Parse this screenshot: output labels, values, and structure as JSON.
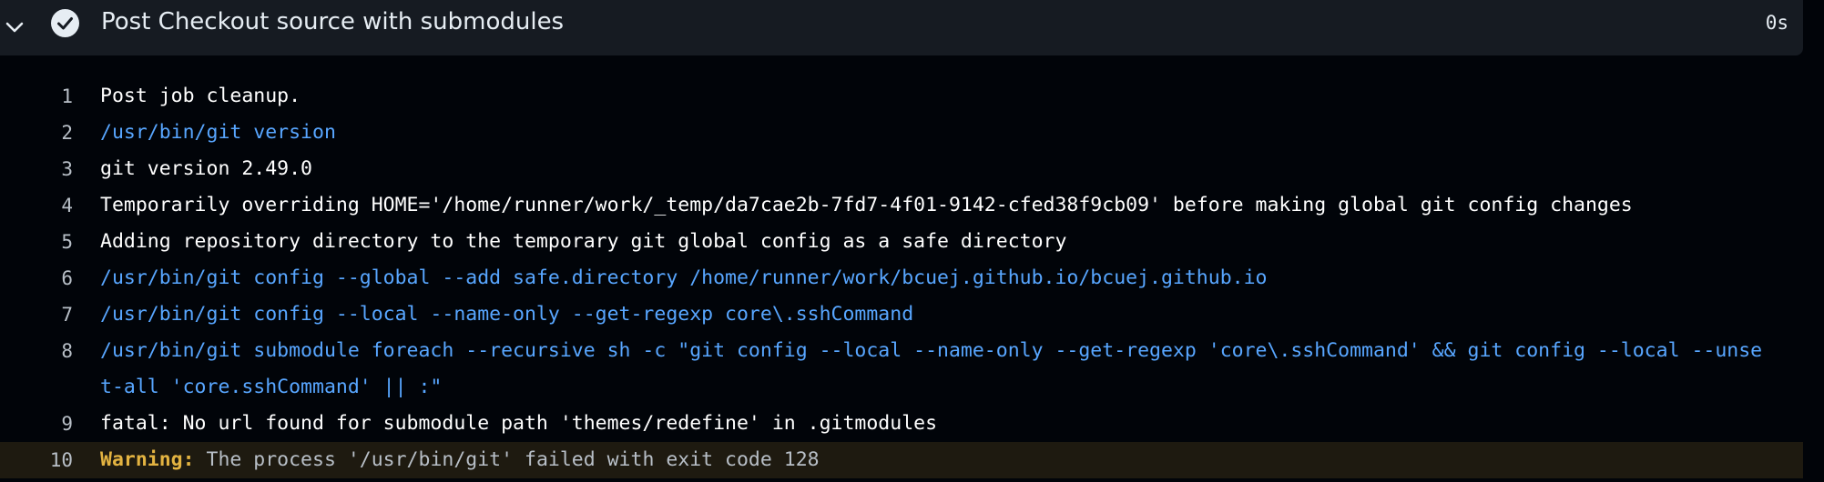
{
  "step": {
    "title": "Post Checkout source with submodules",
    "duration": "0s",
    "status": "success",
    "expanded_icon": "chevron-down-icon",
    "status_icon": "check-circle-icon"
  },
  "colors": {
    "background": "#010409",
    "header_background": "#161b22",
    "command": "#58a6ff",
    "warning_label": "#e3b341",
    "warning_row": "#1e1a10"
  },
  "log": {
    "lines": [
      {
        "no": "1",
        "text": "Post job cleanup.",
        "kind": "normal"
      },
      {
        "no": "2",
        "text": "/usr/bin/git version",
        "kind": "command"
      },
      {
        "no": "3",
        "text": "git version 2.49.0",
        "kind": "normal"
      },
      {
        "no": "4",
        "text": "Temporarily overriding HOME='/home/runner/work/_temp/da7cae2b-7fd7-4f01-9142-cfed38f9cb09' before making global git config changes",
        "kind": "normal"
      },
      {
        "no": "5",
        "text": "Adding repository directory to the temporary git global config as a safe directory",
        "kind": "normal"
      },
      {
        "no": "6",
        "text": "/usr/bin/git config --global --add safe.directory /home/runner/work/bcuej.github.io/bcuej.github.io",
        "kind": "command"
      },
      {
        "no": "7",
        "text": "/usr/bin/git config --local --name-only --get-regexp core\\.sshCommand",
        "kind": "command"
      },
      {
        "no": "8",
        "text": "/usr/bin/git submodule foreach --recursive sh -c \"git config --local --name-only --get-regexp 'core\\.sshCommand' && git config --local --unset-all 'core.sshCommand' || :\"",
        "kind": "command"
      },
      {
        "no": "9",
        "text": "fatal: No url found for submodule path 'themes/redefine' in .gitmodules",
        "kind": "normal"
      },
      {
        "no": "10",
        "label": "Warning:",
        "text": " The process '/usr/bin/git' failed with exit code 128",
        "kind": "warning"
      }
    ]
  }
}
